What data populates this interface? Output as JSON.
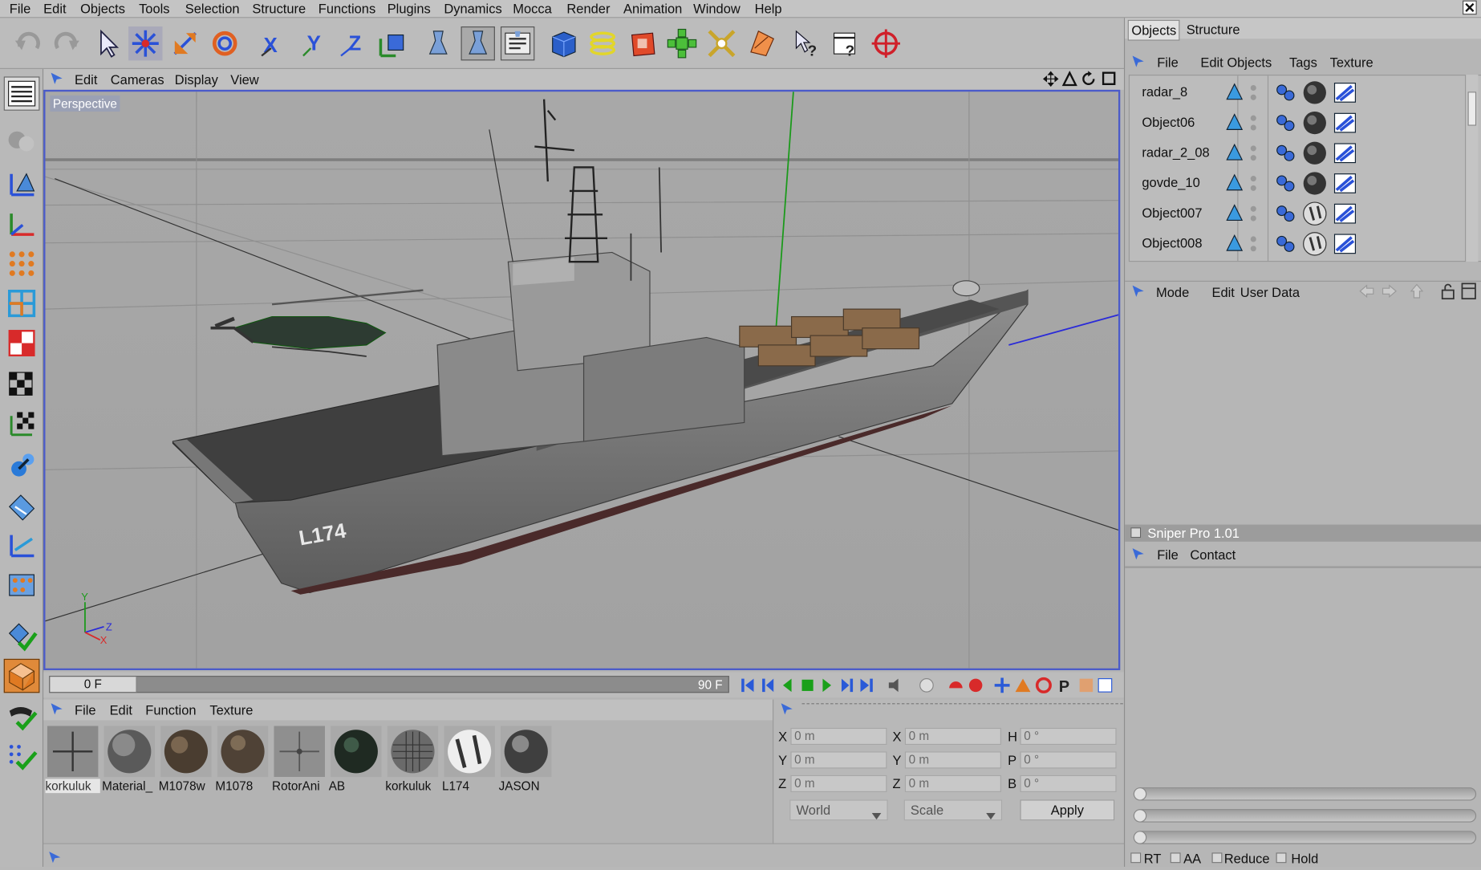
{
  "menu": [
    "File",
    "Edit",
    "Objects",
    "Tools",
    "Selection",
    "Structure",
    "Functions",
    "Plugins",
    "Dynamics",
    "Mocca",
    "Render",
    "Animation",
    "Window",
    "Help"
  ],
  "viewport": {
    "menu": [
      "Edit",
      "Cameras",
      "Display",
      "View"
    ],
    "camera_label": "Perspective",
    "hull_text": "L174"
  },
  "timeline": {
    "start": "0 F",
    "end": "90 F"
  },
  "materials": {
    "menu": [
      "File",
      "Edit",
      "Function",
      "Texture"
    ],
    "items": [
      "korkuluk",
      "Material_",
      "M1078w",
      "M1078",
      "RotorAni",
      "AB",
      "korkuluk",
      "L174",
      "JASON"
    ]
  },
  "coords": {
    "rows": [
      {
        "a": "X",
        "va": "0 m",
        "b": "X",
        "vb": "0 m",
        "c": "H",
        "vc": "0 °"
      },
      {
        "a": "Y",
        "va": "0 m",
        "b": "Y",
        "vb": "0 m",
        "c": "P",
        "vc": "0 °"
      },
      {
        "a": "Z",
        "va": "0 m",
        "b": "Z",
        "vb": "0 m",
        "c": "B",
        "vc": "0 °"
      }
    ],
    "world": "World",
    "scale": "Scale",
    "apply": "Apply"
  },
  "objects_panel": {
    "tabs": [
      "Objects",
      "Structure"
    ],
    "menu": [
      "File",
      "Edit",
      "Objects",
      "Tags",
      "Texture"
    ],
    "rows": [
      "radar_8",
      "Object06",
      "radar_2_08",
      "govde_10",
      "Object007",
      "Object008"
    ]
  },
  "attributes": {
    "menu": [
      "Mode",
      "Edit",
      "User Data"
    ]
  },
  "plugin": {
    "title": "Sniper Pro 1.01",
    "menu": [
      "File",
      "Contact"
    ]
  },
  "render_opts": [
    "RT",
    "AA",
    "Reduce",
    "Hold"
  ]
}
